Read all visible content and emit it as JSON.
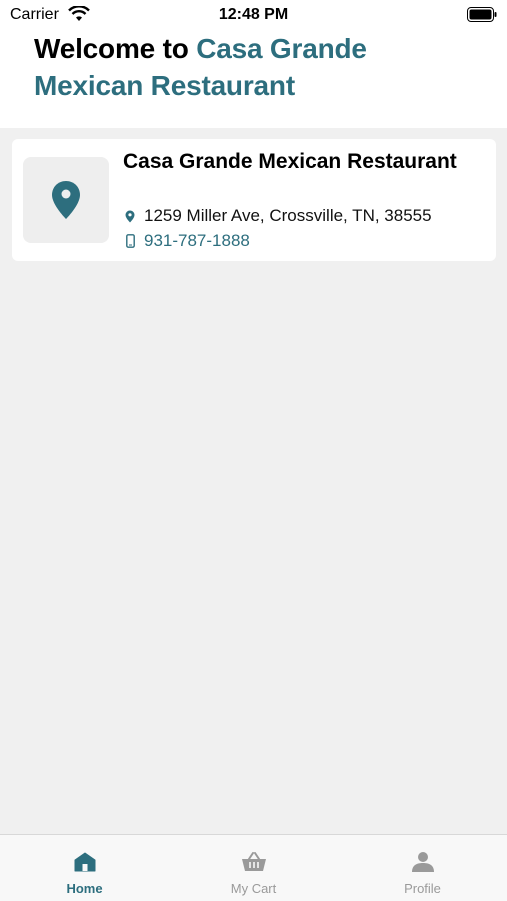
{
  "status_bar": {
    "carrier": "Carrier",
    "time": "12:48 PM"
  },
  "header": {
    "welcome_prefix": "Welcome to ",
    "restaurant_name": "Casa Grande Mexican Restaurant"
  },
  "restaurant_card": {
    "name": "Casa Grande Mexican Restaurant",
    "address": "1259 Miller Ave, Crossville, TN, 38555",
    "phone": "931-787-1888",
    "thumb_icon": "map-pin-icon"
  },
  "tab_bar": {
    "tabs": [
      {
        "label": "Home",
        "icon": "home-icon",
        "active": true
      },
      {
        "label": "My Cart",
        "icon": "cart-icon",
        "active": false
      },
      {
        "label": "Profile",
        "icon": "profile-icon",
        "active": false
      }
    ]
  },
  "colors": {
    "accent": "#2d6e7e",
    "inactive": "#9a9a9a",
    "background": "#f0f0f0"
  }
}
